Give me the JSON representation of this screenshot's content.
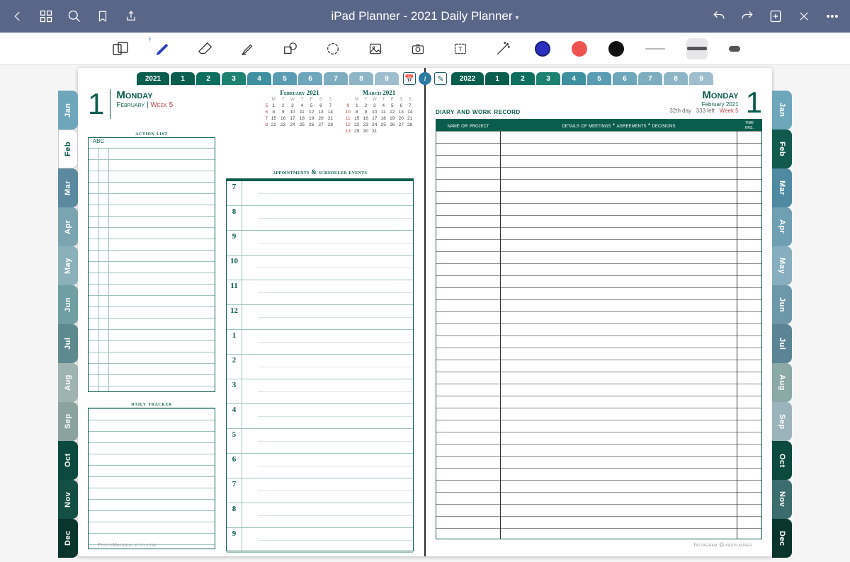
{
  "titlebar": {
    "title": "iPad Planner - 2021 Daily Planner"
  },
  "toptabs": {
    "left": {
      "year": "2021",
      "nums": [
        "1",
        "2",
        "3",
        "4",
        "5",
        "6",
        "7",
        "8",
        "9"
      ]
    },
    "right": {
      "year": "2022",
      "nums": [
        "1",
        "2",
        "3",
        "4",
        "5",
        "6",
        "7",
        "8",
        "9"
      ]
    }
  },
  "months": [
    "Jan",
    "Feb",
    "Mar",
    "Apr",
    "May",
    "Jun",
    "Jul",
    "Aug",
    "Sep",
    "Oct",
    "Nov",
    "Dec"
  ],
  "leftpage": {
    "daynum": "1",
    "dayname": "Monday",
    "month": "February",
    "week": "Week 5",
    "actionlist_caption": "action list",
    "action_hdr_abc": "ABC",
    "daily_caption": "daily tracker",
    "appt_caption": "appointments & scheduled events",
    "hours": [
      "7",
      "8",
      "9",
      "10",
      "11",
      "12",
      "1",
      "2",
      "3",
      "4",
      "5",
      "6",
      "7",
      "8",
      "9"
    ],
    "minical1": {
      "title": "February 2021",
      "dows": [
        "M",
        "T",
        "W",
        "T",
        "F",
        "S",
        "S"
      ],
      "rows": [
        [
          "",
          "1",
          "2",
          "3",
          "4",
          "5",
          "6",
          "7"
        ],
        [
          "",
          "8",
          "9",
          "10",
          "11",
          "12",
          "13",
          "14"
        ],
        [
          "",
          "15",
          "16",
          "17",
          "18",
          "19",
          "20",
          "21"
        ],
        [
          "",
          "22",
          "23",
          "24",
          "25",
          "26",
          "27",
          "28"
        ]
      ],
      "wk": [
        "5",
        "6",
        "7",
        "8"
      ]
    },
    "minical2": {
      "title": "March 2021",
      "dows": [
        "M",
        "T",
        "W",
        "T",
        "F",
        "S",
        "S"
      ],
      "rows": [
        [
          "",
          "1",
          "2",
          "3",
          "4",
          "5",
          "6",
          "7"
        ],
        [
          "",
          "8",
          "9",
          "10",
          "11",
          "12",
          "13",
          "14"
        ],
        [
          "",
          "15",
          "16",
          "17",
          "18",
          "19",
          "20",
          "21"
        ],
        [
          "",
          "22",
          "23",
          "24",
          "25",
          "26",
          "27",
          "28"
        ],
        [
          "",
          "29",
          "30",
          "31",
          "",
          "",
          "",
          ""
        ]
      ],
      "wk": [
        "9",
        "10",
        "11",
        "12",
        "13"
      ]
    },
    "footer": "PhotoMaterial.etsy.com"
  },
  "rightpage": {
    "title": "diary and work record",
    "dayname": "Monday",
    "sub": "February 2021",
    "daynum": "1",
    "stat1": "32th day",
    "stat2": "333 left",
    "week": "Week 5",
    "col1": "name or project",
    "col2": "details of meetings * agreements * decisions",
    "col3": "time\nhrs.",
    "footer": "Instagram @ipadplanner"
  }
}
